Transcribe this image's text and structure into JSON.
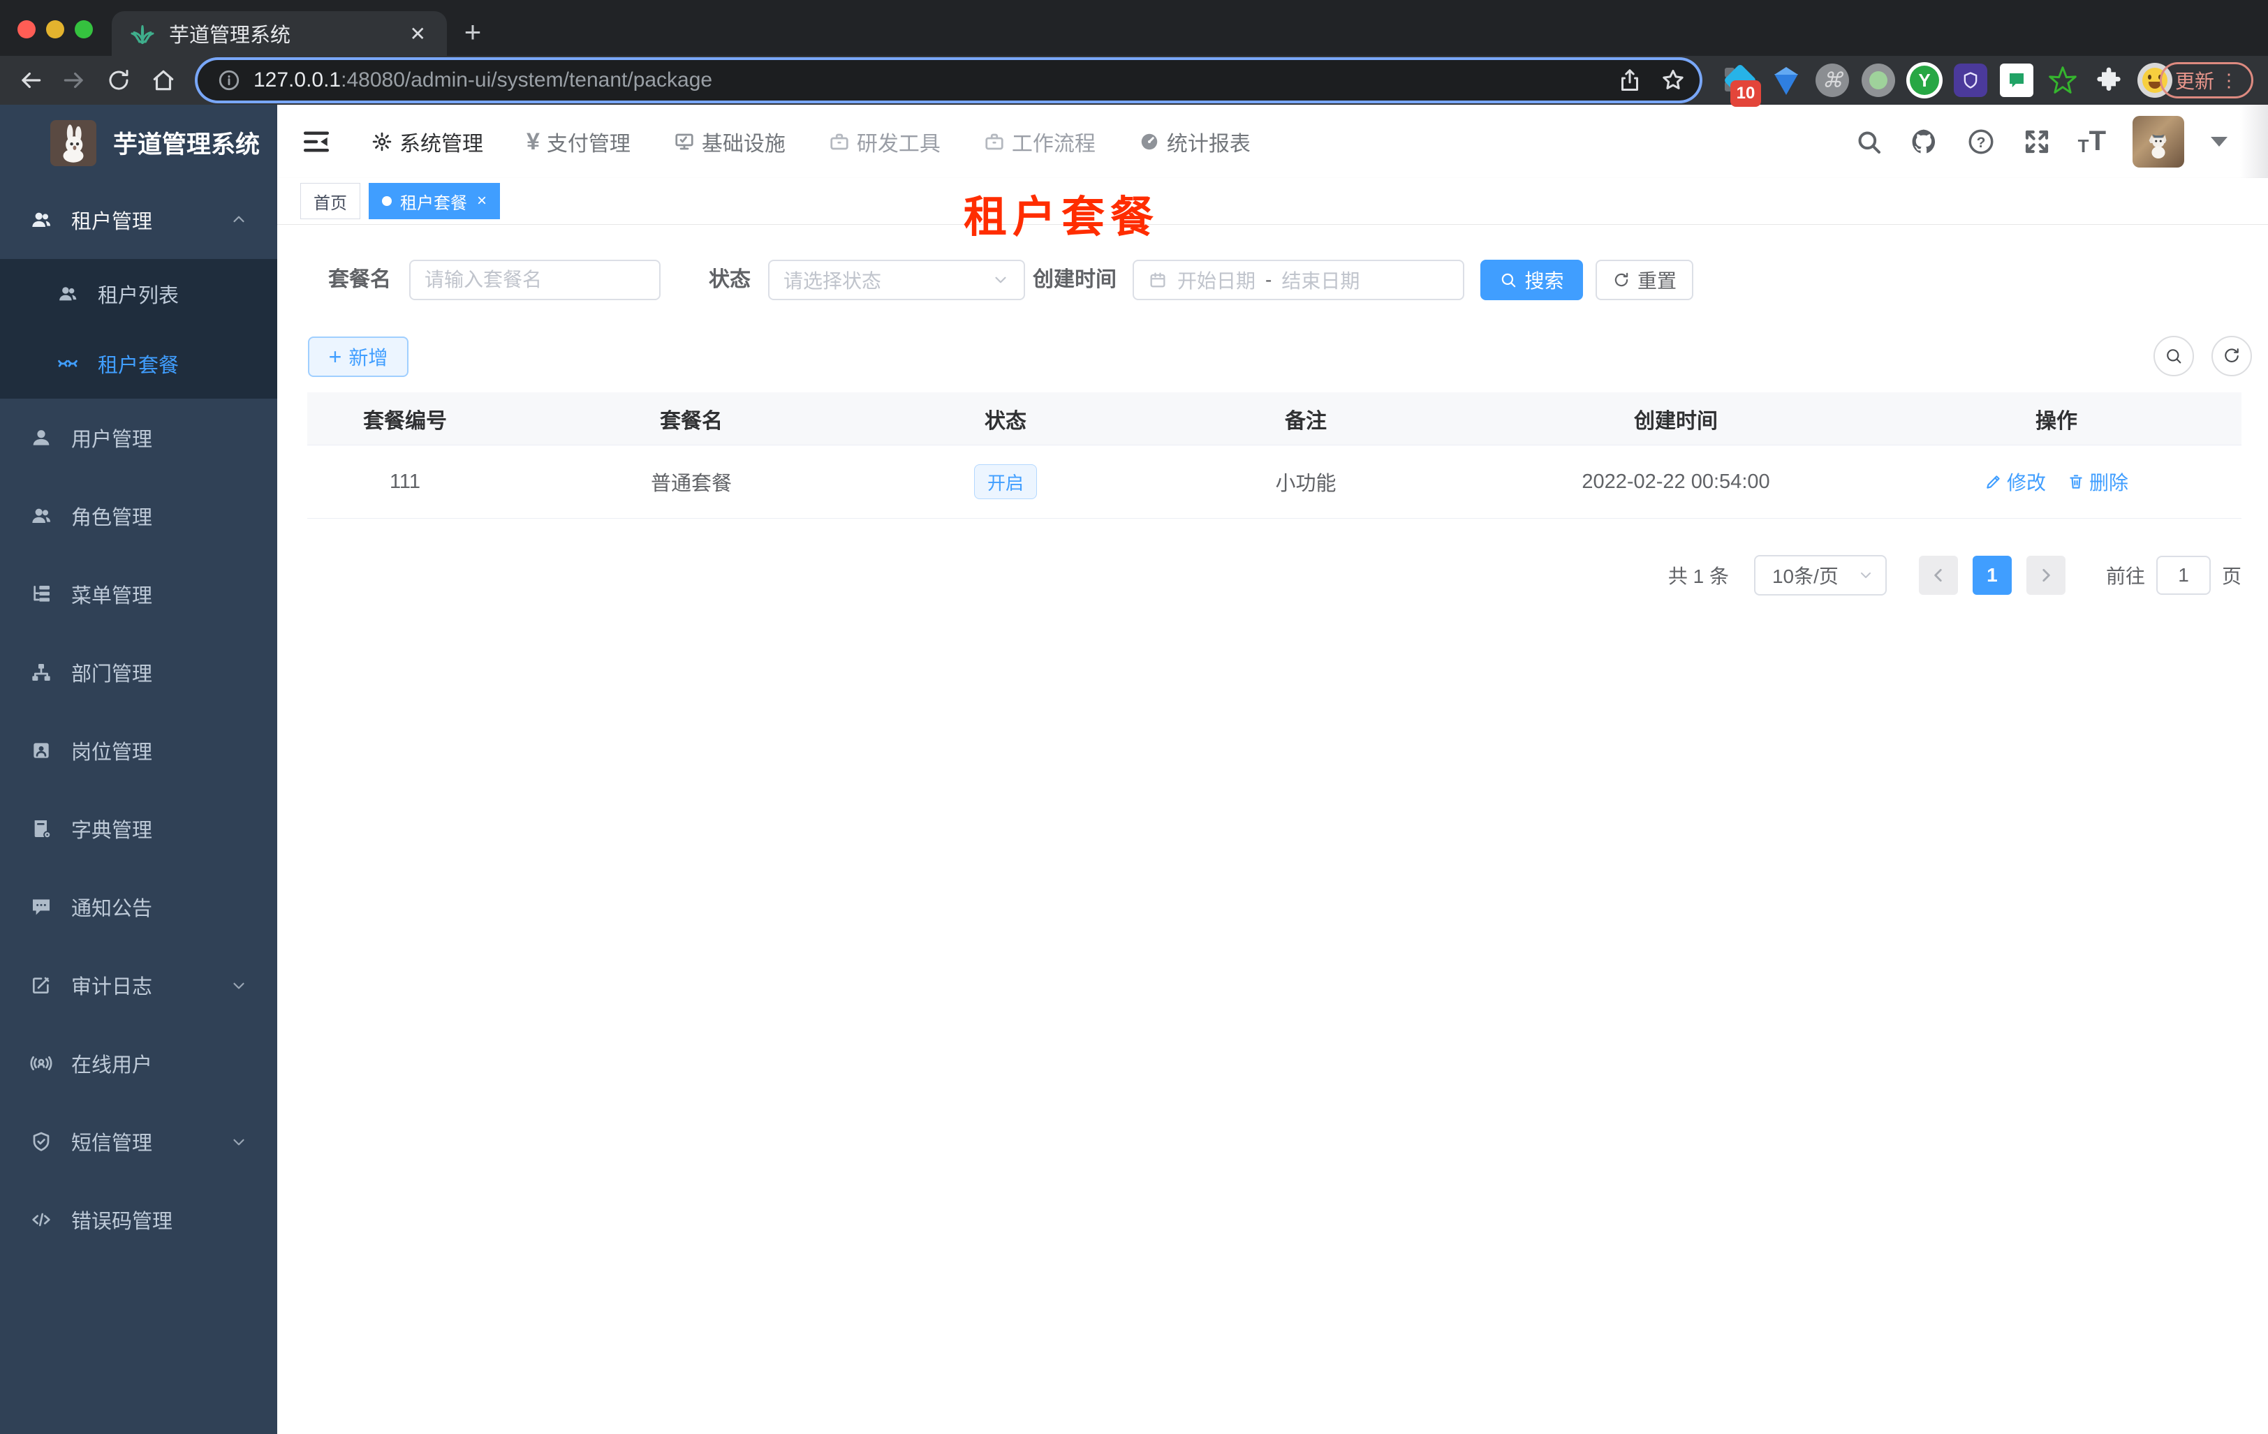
{
  "colors": {
    "accent": "#409eff",
    "sidebar_bg": "#304156",
    "submenu_bg": "#1f2d3d",
    "overlay_red": "#ff2d00",
    "update_pill": "#e8968c"
  },
  "browser": {
    "tab_title": "芋道管理系统",
    "url_host": "127.0.0.1",
    "url_path": ":48080/admin-ui/system/tenant/package",
    "extension_badge": "10",
    "update_label": "更新"
  },
  "glyphs": {
    "tab_close": "✕",
    "plus": "+",
    "tag_close": "×",
    "yen": "¥",
    "command": "⌘",
    "dots_vertical": "⋮",
    "question": "?",
    "letter_y": "Y",
    "t_small": "T",
    "t_large": "T"
  },
  "sidebar": {
    "title": "芋道管理系统",
    "items": [
      {
        "label": "租户管理"
      },
      {
        "label": "租户列表"
      },
      {
        "label": "租户套餐"
      },
      {
        "label": "用户管理"
      },
      {
        "label": "角色管理"
      },
      {
        "label": "菜单管理"
      },
      {
        "label": "部门管理"
      },
      {
        "label": "岗位管理"
      },
      {
        "label": "字典管理"
      },
      {
        "label": "通知公告"
      },
      {
        "label": "审计日志"
      },
      {
        "label": "在线用户"
      },
      {
        "label": "短信管理"
      },
      {
        "label": "错误码管理"
      }
    ]
  },
  "topnav": {
    "items": [
      "系统管理",
      "支付管理",
      "基础设施",
      "研发工具",
      "工作流程",
      "统计报表"
    ]
  },
  "tags": {
    "home": "首页",
    "active": "租户套餐"
  },
  "overlay_label": "租户套餐",
  "filters": {
    "name_label": "套餐名",
    "name_placeholder": "请输入套餐名",
    "status_label": "状态",
    "status_placeholder": "请选择状态",
    "date_label": "创建时间",
    "date_start_placeholder": "开始日期",
    "date_separator": "-",
    "date_end_placeholder": "结束日期",
    "search_button": "搜索",
    "reset_button": "重置",
    "add_button": "新增"
  },
  "table": {
    "columns": [
      "套餐编号",
      "套餐名",
      "状态",
      "备注",
      "创建时间",
      "操作"
    ],
    "rows": [
      {
        "id": "111",
        "name": "普通套餐",
        "status": "开启",
        "remark": "小功能",
        "created": "2022-02-22 00:54:00",
        "action_edit": "修改",
        "action_delete": "删除"
      }
    ]
  },
  "pagination": {
    "total": "共 1 条",
    "page_size": "10条/页",
    "current": "1",
    "goto_label": "前往",
    "goto_value": "1",
    "page_unit": "页"
  }
}
